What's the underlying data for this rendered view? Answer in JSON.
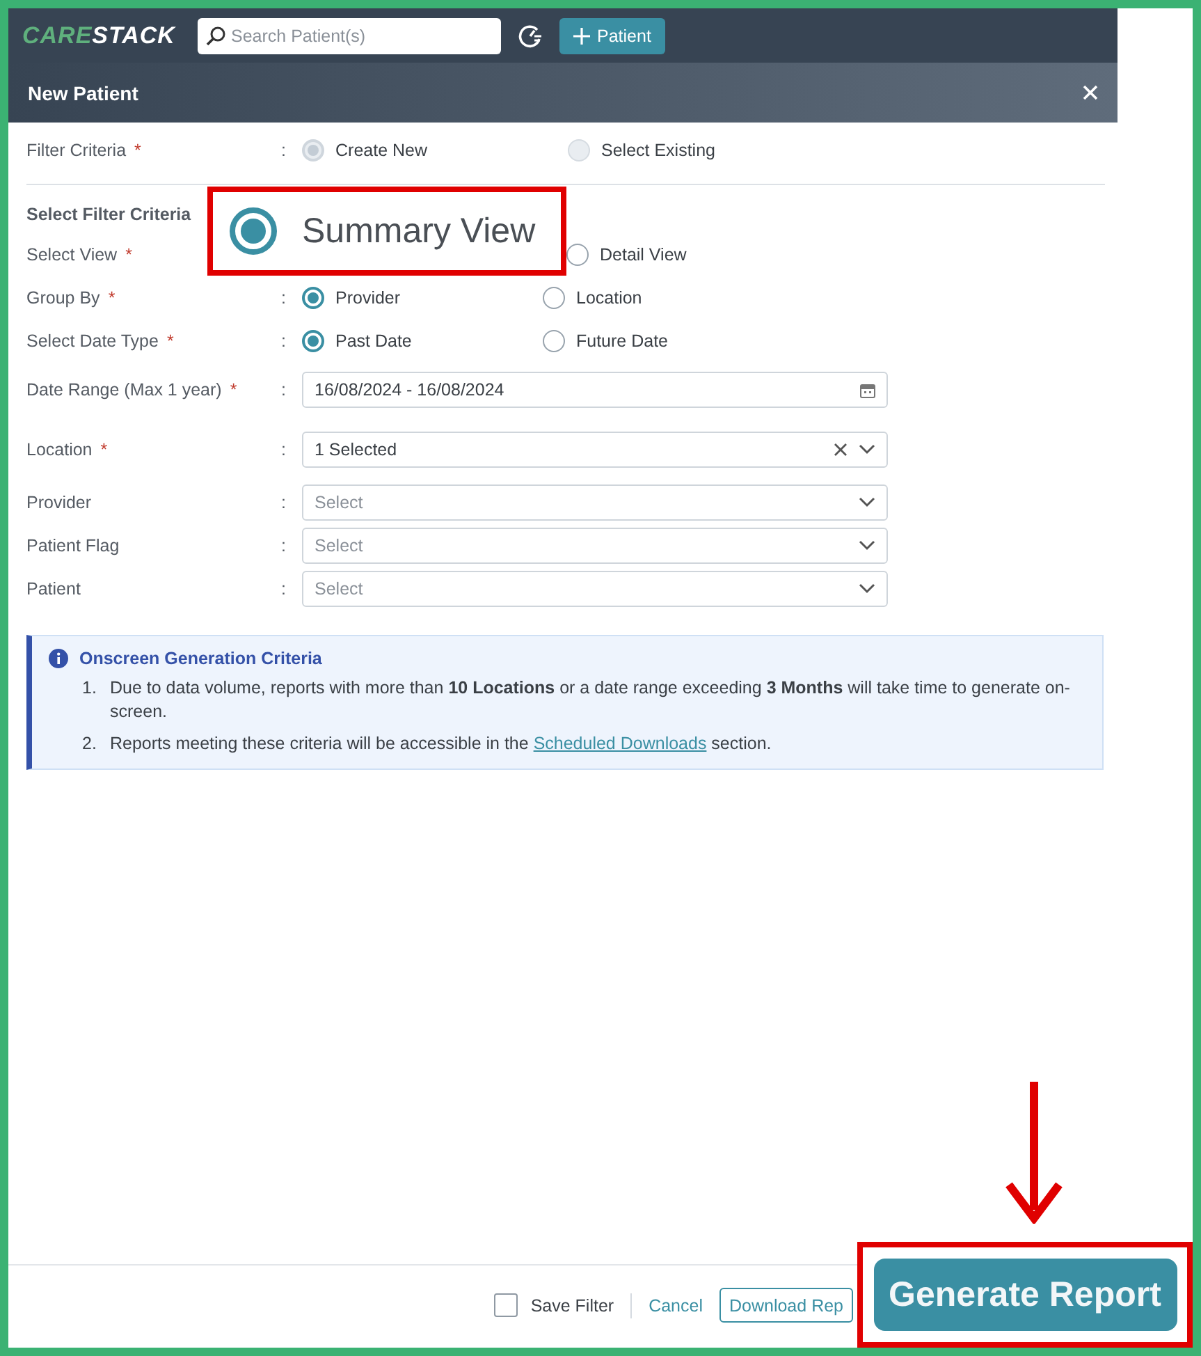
{
  "header": {
    "logo_left": "CARE",
    "logo_right": "STACK",
    "search": {
      "placeholder": "Search Patient(s)"
    },
    "add_button": "Patient"
  },
  "modal": {
    "title": "New Patient"
  },
  "filter_criteria": {
    "label": "Filter Criteria",
    "required_mark": "*",
    "colon": ":",
    "options": [
      {
        "label": "Create New",
        "selected": true,
        "disabled": true
      },
      {
        "label": "Select Existing",
        "selected": false,
        "disabled": true
      }
    ]
  },
  "section_title": "Select Filter Criteria",
  "rows": [
    {
      "kind": "radio",
      "label": "Select View",
      "required_mark": "*",
      "options": [
        {
          "label": "Summary View",
          "selected": true,
          "highlighted": true
        },
        {
          "label": "Detail View",
          "selected": false
        }
      ]
    },
    {
      "kind": "radio",
      "label": "Group By",
      "required_mark": "*",
      "colon": ":",
      "options": [
        {
          "label": "Provider",
          "selected": true
        },
        {
          "label": "Location",
          "selected": false
        }
      ]
    },
    {
      "kind": "radio",
      "label": "Select Date Type",
      "required_mark": "*",
      "colon": ":",
      "options": [
        {
          "label": "Past Date",
          "selected": true
        },
        {
          "label": "Future Date",
          "selected": false
        }
      ]
    },
    {
      "kind": "date",
      "label": "Date Range (Max 1 year)",
      "required_mark": "*",
      "colon": ":",
      "value": "16/08/2024 - 16/08/2024"
    },
    {
      "kind": "select",
      "label": "Location",
      "required_mark": "*",
      "colon": ":",
      "value": "1 Selected",
      "clearable": true
    },
    {
      "kind": "select",
      "label": "Provider",
      "colon": ":",
      "placeholder": "Select"
    },
    {
      "kind": "select",
      "label": "Patient Flag",
      "colon": ":",
      "placeholder": "Select"
    },
    {
      "kind": "select",
      "label": "Patient",
      "colon": ":",
      "placeholder": "Select"
    }
  ],
  "info": {
    "title": "Onscreen Generation Criteria",
    "items": [
      {
        "number": "1.",
        "text": "Due to data volume, reports with more than **10 Locations** or a date range exceeding **3 Months** will take time to generate on-screen."
      },
      {
        "number": "2.",
        "text": "Reports meeting these criteria will be accessible in the ",
        "link": "Scheduled Downloads",
        "text_after": " section."
      }
    ]
  },
  "footer": {
    "save_filter": {
      "label": "Save Filter",
      "checked": false
    },
    "cancel": "Cancel",
    "download": "Download Rep",
    "generate": {
      "label": "Generate Report",
      "highlighted": true
    }
  }
}
